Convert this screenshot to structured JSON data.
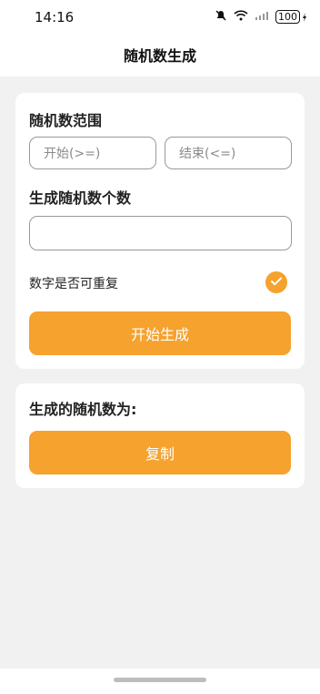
{
  "status": {
    "time": "14:16",
    "battery": "100"
  },
  "page": {
    "title": "随机数生成"
  },
  "range": {
    "label": "随机数范围",
    "start_placeholder": "开始(>=)",
    "end_placeholder": "结束(<=)"
  },
  "count": {
    "label": "生成随机数个数",
    "value": ""
  },
  "repeat": {
    "label": "数字是否可重复",
    "checked": true
  },
  "actions": {
    "generate_label": "开始生成",
    "copy_label": "复制"
  },
  "result": {
    "label": "生成的随机数为:"
  },
  "colors": {
    "accent": "#f5a22e",
    "background": "#f1f1f1",
    "card": "#ffffff"
  },
  "icons": [
    "mute-icon",
    "wifi-icon",
    "signal-icon",
    "battery-icon",
    "check-icon"
  ]
}
